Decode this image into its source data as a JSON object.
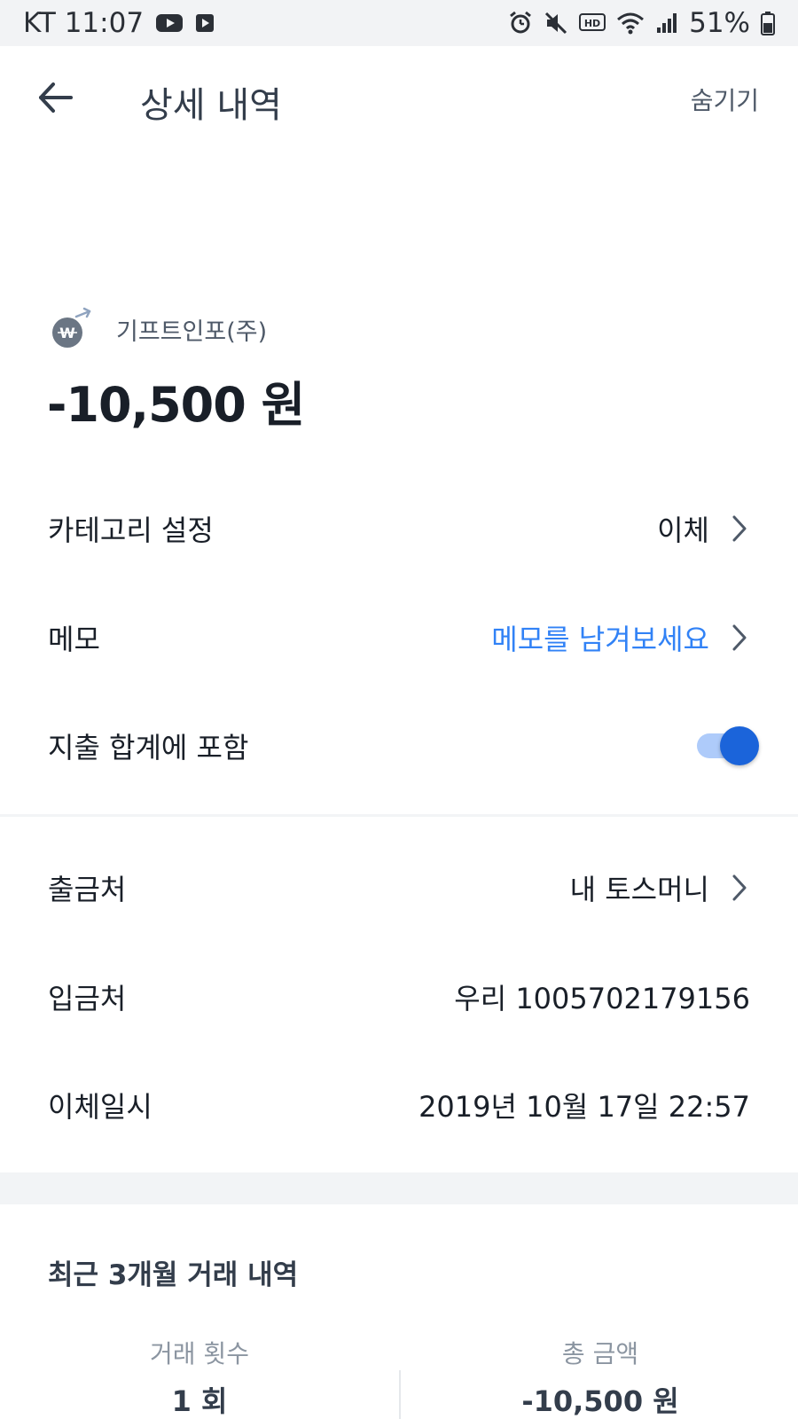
{
  "status_bar": {
    "carrier_time": "KT 11:07",
    "battery": "51%",
    "icons": [
      "youtube-icon",
      "play-store-icon",
      "alarm-icon",
      "mute-icon",
      "hd-icon",
      "wifi-icon",
      "signal-icon",
      "battery-icon"
    ]
  },
  "header": {
    "title": "상세 내역",
    "hide_label": "숨기기"
  },
  "transaction": {
    "merchant": "기프트인포(주)",
    "amount": "-10,500 원"
  },
  "settings": {
    "category": {
      "label": "카테고리 설정",
      "value": "이체"
    },
    "memo": {
      "label": "메모",
      "placeholder": "메모를 남겨보세요"
    },
    "include_total": {
      "label": "지출 합계에 포함",
      "enabled": true
    }
  },
  "details": {
    "withdraw": {
      "label": "출금처",
      "value": "내 토스머니"
    },
    "deposit": {
      "label": "입금처",
      "value": "우리 1005702179156"
    },
    "datetime": {
      "label": "이체일시",
      "value": "2019년 10월 17일 22:57"
    }
  },
  "recent": {
    "title": "최근 3개월 거래 내역",
    "count_label": "거래 횟수",
    "count_value": "1 회",
    "total_label": "총 금액",
    "total_value": "-10,500 원"
  },
  "colors": {
    "accent": "#3182f6",
    "toggle_on": "#1b64da",
    "text_primary": "#191f28",
    "text_secondary": "#8b95a1"
  }
}
